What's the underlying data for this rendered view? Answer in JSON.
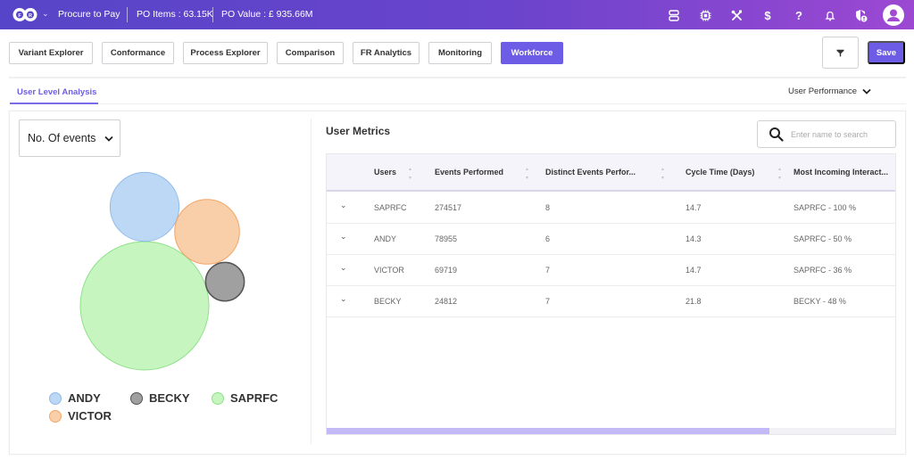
{
  "header": {
    "app_name": "Procure to Pay",
    "po_items": "PO Items : 63.15K",
    "po_value": "PO Value : £ 935.66M",
    "icons": [
      "server-icon",
      "chip-icon",
      "tools-icon",
      "dollar-icon",
      "help-icon",
      "bell-icon",
      "shield-user-icon",
      "user-avatar-icon"
    ]
  },
  "toolbar": {
    "tabs": [
      {
        "label": "Variant Explorer",
        "active": false
      },
      {
        "label": "Conformance",
        "active": false
      },
      {
        "label": "Process Explorer",
        "active": false
      },
      {
        "label": "Comparison",
        "active": false
      },
      {
        "label": "FR Analytics",
        "active": false
      },
      {
        "label": "Monitoring",
        "active": false
      },
      {
        "label": "Workforce",
        "active": true
      }
    ],
    "save_label": "Save",
    "filter_icon": "filter-icon"
  },
  "subnav": {
    "active_tab": "User Level Analysis",
    "view_select": "User Performance"
  },
  "left_panel": {
    "metric_select": "No. Of events",
    "legend": [
      {
        "name": "ANDY",
        "color": "#bcd8f5",
        "stroke": "#8fbaea"
      },
      {
        "name": "BECKY",
        "color": "#a0a0a0",
        "stroke": "#555555"
      },
      {
        "name": "SAPRFC",
        "color": "#c6f5c0",
        "stroke": "#8fe089"
      },
      {
        "name": "VICTOR",
        "color": "#f9cfa9",
        "stroke": "#f0a66a"
      }
    ]
  },
  "chart_data": {
    "type": "bubble",
    "title": "",
    "metric": "No. Of events",
    "series": [
      {
        "name": "SAPRFC",
        "value": 274517,
        "color": "#c6f5c0"
      },
      {
        "name": "ANDY",
        "value": 78955,
        "color": "#bcd8f5"
      },
      {
        "name": "VICTOR",
        "value": 69719,
        "color": "#f9cfa9"
      },
      {
        "name": "BECKY",
        "value": 24812,
        "color": "#a0a0a0"
      }
    ],
    "legend_position": "bottom"
  },
  "metrics": {
    "title": "User Metrics",
    "search_placeholder": "Enter name to search",
    "columns": [
      "Users",
      "Events Performed",
      "Distinct Events Perfor...",
      "Cycle Time (Days)",
      "Most Incoming Interact..."
    ],
    "rows": [
      {
        "user": "SAPRFC",
        "events": "274517",
        "distinct": "8",
        "cycle": "14.7",
        "incoming": "SAPRFC - 100 %"
      },
      {
        "user": "ANDY",
        "events": "78955",
        "distinct": "6",
        "cycle": "14.3",
        "incoming": "SAPRFC - 50 %"
      },
      {
        "user": "VICTOR",
        "events": "69719",
        "distinct": "7",
        "cycle": "14.7",
        "incoming": "SAPRFC - 36 %"
      },
      {
        "user": "BECKY",
        "events": "24812",
        "distinct": "7",
        "cycle": "21.8",
        "incoming": "BECKY - 48 %"
      }
    ],
    "scroll_fraction": 0.776
  }
}
